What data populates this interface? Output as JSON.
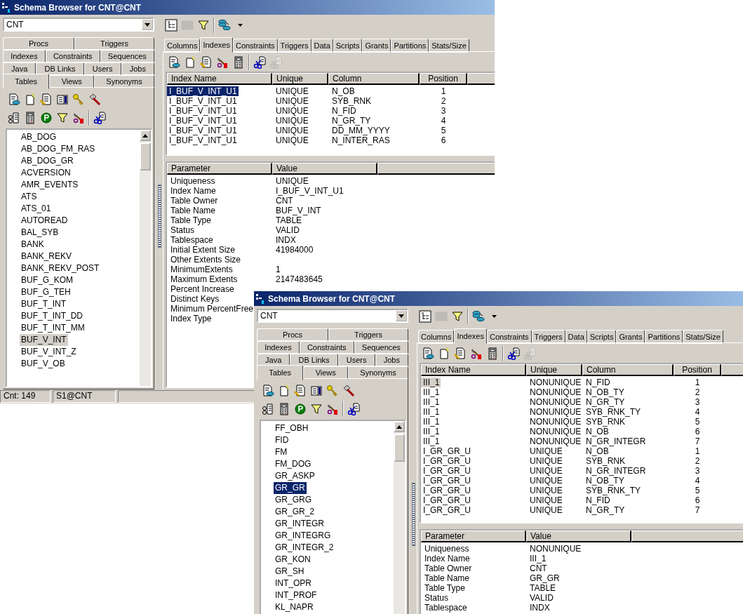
{
  "windows": [
    {
      "title": "Schema Browser for CNT@CNT",
      "list_focused": false,
      "schema": "CNT",
      "toolbar": [
        {
          "kind": "tree",
          "disabled": false
        },
        {
          "kind": "grid",
          "disabled": true
        },
        {
          "kind": "filter",
          "disabled": false
        },
        {
          "kind": "separator"
        },
        {
          "kind": "database",
          "disabled": false
        },
        {
          "kind": "caret",
          "disabled": false
        }
      ],
      "object_tabs": [
        [
          {
            "label": "Procs",
            "selected": false
          },
          {
            "label": "Triggers",
            "selected": false
          }
        ],
        [
          {
            "label": "Indexes",
            "selected": false
          },
          {
            "label": "Constraints",
            "selected": false
          },
          {
            "label": "Sequences",
            "selected": false
          }
        ],
        [
          {
            "label": "Java",
            "selected": false
          },
          {
            "label": "DB Links",
            "selected": false
          },
          {
            "label": "Users",
            "selected": false
          },
          {
            "label": "Jobs",
            "selected": false
          }
        ],
        [
          {
            "label": "Tables",
            "selected": true
          },
          {
            "label": "Views",
            "selected": false
          },
          {
            "label": "Synonyms",
            "selected": false
          }
        ]
      ],
      "object_toolbar": [
        [
          {
            "kind": "database-doc",
            "disabled": false
          },
          {
            "kind": "new-doc",
            "disabled": false
          },
          {
            "kind": "edit-doc",
            "disabled": false
          },
          {
            "kind": "columns",
            "disabled": false
          },
          {
            "kind": "key",
            "disabled": false
          },
          {
            "kind": "hammer",
            "disabled": false
          }
        ],
        [
          {
            "kind": "link-doc",
            "disabled": false
          },
          {
            "kind": "calculator",
            "disabled": false
          },
          {
            "kind": "p-circle",
            "disabled": false
          },
          {
            "kind": "filter",
            "disabled": false
          },
          {
            "kind": "tools",
            "disabled": false
          },
          {
            "kind": "separator"
          },
          {
            "kind": "scissors-doc",
            "disabled": false
          }
        ]
      ],
      "objects": [
        {
          "label": "AB_DOG",
          "selected": false
        },
        {
          "label": "AB_DOG_FM_RAS",
          "selected": false
        },
        {
          "label": "AB_DOG_GR",
          "selected": false
        },
        {
          "label": "ACVERSION",
          "selected": false
        },
        {
          "label": "AMR_EVENTS",
          "selected": false
        },
        {
          "label": "ATS",
          "selected": false
        },
        {
          "label": "ATS_01",
          "selected": false
        },
        {
          "label": "AUTOREAD",
          "selected": false
        },
        {
          "label": "BAL_SYB",
          "selected": false
        },
        {
          "label": "BANK",
          "selected": false
        },
        {
          "label": "BANK_REKV",
          "selected": false
        },
        {
          "label": "BANK_REKV_POST",
          "selected": false
        },
        {
          "label": "BUF_G_KOM",
          "selected": false
        },
        {
          "label": "BUF_G_TEH",
          "selected": false
        },
        {
          "label": "BUF_T_INT",
          "selected": false
        },
        {
          "label": "BUF_T_INT_DD",
          "selected": false
        },
        {
          "label": "BUF_T_INT_MM",
          "selected": false
        },
        {
          "label": "BUF_V_INT",
          "selected": true
        },
        {
          "label": "BUF_V_INT_Z",
          "selected": false
        },
        {
          "label": "BUF_V_OB",
          "selected": false
        }
      ],
      "detail_tabs": [
        {
          "label": "Columns",
          "selected": false
        },
        {
          "label": "Indexes",
          "selected": true
        },
        {
          "label": "Constraints",
          "selected": false
        },
        {
          "label": "Triggers",
          "selected": false
        },
        {
          "label": "Data",
          "selected": false
        },
        {
          "label": "Scripts",
          "selected": false
        },
        {
          "label": "Grants",
          "selected": false
        },
        {
          "label": "Partitions",
          "selected": false
        },
        {
          "label": "Stats/Size",
          "selected": false
        }
      ],
      "detail_toolbar": [
        {
          "kind": "database-doc",
          "disabled": false
        },
        {
          "kind": "new-doc",
          "disabled": false
        },
        {
          "kind": "edit-doc",
          "disabled": false
        },
        {
          "kind": "tools",
          "disabled": false
        },
        {
          "kind": "calculator",
          "disabled": false
        },
        {
          "kind": "separator"
        },
        {
          "kind": "scissors-doc",
          "disabled": false
        },
        {
          "kind": "scissors-doc",
          "disabled": true
        }
      ],
      "indexes": {
        "columns": [
          "Index Name",
          "Unique",
          "Column",
          "Position"
        ],
        "rows": [
          {
            "cells": [
              "I_BUF_V_INT_U1",
              "UNIQUE",
              "N_OB",
              "1"
            ],
            "selected": true
          },
          {
            "cells": [
              "I_BUF_V_INT_U1",
              "UNIQUE",
              "SYB_RNK",
              "2"
            ],
            "selected": false
          },
          {
            "cells": [
              "I_BUF_V_INT_U1",
              "UNIQUE",
              "N_FID",
              "3"
            ],
            "selected": false
          },
          {
            "cells": [
              "I_BUF_V_INT_U1",
              "UNIQUE",
              "N_GR_TY",
              "4"
            ],
            "selected": false
          },
          {
            "cells": [
              "I_BUF_V_INT_U1",
              "UNIQUE",
              "DD_MM_YYYY",
              "5"
            ],
            "selected": false
          },
          {
            "cells": [
              "I_BUF_V_INT_U1",
              "UNIQUE",
              "N_INTER_RAS",
              "6"
            ],
            "selected": false
          }
        ]
      },
      "parameters": {
        "columns": [
          "Parameter",
          "Value"
        ],
        "rows": [
          [
            "Uniqueness",
            "UNIQUE"
          ],
          [
            "Index Name",
            "I_BUF_V_INT_U1"
          ],
          [
            "Table Owner",
            "CNT"
          ],
          [
            "Table Name",
            "BUF_V_INT"
          ],
          [
            "Table Type",
            "TABLE"
          ],
          [
            "Status",
            "VALID"
          ],
          [
            "Tablespace",
            "INDX"
          ],
          [
            "Initial Extent Size",
            "41984000"
          ],
          [
            "Other Extents Size"
          ],
          [
            "MinimumExtents",
            "1"
          ],
          [
            "Maximum Extents",
            "2147483645"
          ],
          [
            "Percent Increase"
          ],
          [
            "Distinct Keys"
          ],
          [
            "Minimum PercentFree"
          ],
          [
            "Index Type"
          ]
        ]
      },
      "status_bar": [
        "Cnt: 149",
        "S1@CNT"
      ]
    },
    {
      "title": "Schema Browser for CNT@CNT",
      "list_focused": true,
      "schema": "CNT",
      "toolbar": [
        {
          "kind": "tree",
          "disabled": false
        },
        {
          "kind": "grid",
          "disabled": true
        },
        {
          "kind": "filter",
          "disabled": false
        },
        {
          "kind": "separator"
        },
        {
          "kind": "database",
          "disabled": false
        },
        {
          "kind": "caret",
          "disabled": false
        }
      ],
      "object_tabs": [
        [
          {
            "label": "Procs",
            "selected": false
          },
          {
            "label": "Triggers",
            "selected": false
          }
        ],
        [
          {
            "label": "Indexes",
            "selected": false
          },
          {
            "label": "Constraints",
            "selected": false
          },
          {
            "label": "Sequences",
            "selected": false
          }
        ],
        [
          {
            "label": "Java",
            "selected": false
          },
          {
            "label": "DB Links",
            "selected": false
          },
          {
            "label": "Users",
            "selected": false
          },
          {
            "label": "Jobs",
            "selected": false
          }
        ],
        [
          {
            "label": "Tables",
            "selected": true
          },
          {
            "label": "Views",
            "selected": false
          },
          {
            "label": "Synonyms",
            "selected": false
          }
        ]
      ],
      "object_toolbar": [
        [
          {
            "kind": "database-doc",
            "disabled": false
          },
          {
            "kind": "new-doc",
            "disabled": false
          },
          {
            "kind": "edit-doc",
            "disabled": false
          },
          {
            "kind": "columns",
            "disabled": false
          },
          {
            "kind": "key",
            "disabled": false
          },
          {
            "kind": "hammer",
            "disabled": false
          }
        ],
        [
          {
            "kind": "link-doc",
            "disabled": false
          },
          {
            "kind": "calculator",
            "disabled": false
          },
          {
            "kind": "p-circle",
            "disabled": false
          },
          {
            "kind": "filter",
            "disabled": false
          },
          {
            "kind": "tools",
            "disabled": false
          },
          {
            "kind": "separator"
          },
          {
            "kind": "scissors-doc",
            "disabled": false
          }
        ]
      ],
      "objects": [
        {
          "label": "FF_OBH",
          "selected": false
        },
        {
          "label": "FID",
          "selected": false
        },
        {
          "label": "FM",
          "selected": false
        },
        {
          "label": "FM_DOG",
          "selected": false
        },
        {
          "label": "GR_ASKP",
          "selected": false
        },
        {
          "label": "GR_GR",
          "selected": true
        },
        {
          "label": "GR_GRG",
          "selected": false
        },
        {
          "label": "GR_GR_2",
          "selected": false
        },
        {
          "label": "GR_INTEGR",
          "selected": false
        },
        {
          "label": "GR_INTEGRG",
          "selected": false
        },
        {
          "label": "GR_INTEGR_2",
          "selected": false
        },
        {
          "label": "GR_KON",
          "selected": false
        },
        {
          "label": "GR_SH",
          "selected": false
        },
        {
          "label": "INT_OPR",
          "selected": false
        },
        {
          "label": "INT_PROF",
          "selected": false
        },
        {
          "label": "KL_NAPR",
          "selected": false
        }
      ],
      "detail_tabs": [
        {
          "label": "Columns",
          "selected": false
        },
        {
          "label": "Indexes",
          "selected": true
        },
        {
          "label": "Constraints",
          "selected": false
        },
        {
          "label": "Triggers",
          "selected": false
        },
        {
          "label": "Data",
          "selected": false
        },
        {
          "label": "Scripts",
          "selected": false
        },
        {
          "label": "Grants",
          "selected": false
        },
        {
          "label": "Partitions",
          "selected": false
        },
        {
          "label": "Stats/Size",
          "selected": false
        }
      ],
      "detail_toolbar": [
        {
          "kind": "database-doc",
          "disabled": false
        },
        {
          "kind": "new-doc",
          "disabled": false
        },
        {
          "kind": "edit-doc",
          "disabled": false
        },
        {
          "kind": "tools",
          "disabled": false
        },
        {
          "kind": "calculator",
          "disabled": false
        },
        {
          "kind": "separator"
        },
        {
          "kind": "scissors-doc",
          "disabled": false
        },
        {
          "kind": "scissors-doc",
          "disabled": true
        }
      ],
      "indexes": {
        "columns": [
          "Index Name",
          "Unique",
          "Column",
          "Position"
        ],
        "rows": [
          {
            "cells": [
              "III_1",
              "NONUNIQUE",
              "N_FID",
              "1"
            ],
            "selected": true
          },
          {
            "cells": [
              "III_1",
              "NONUNIQUE",
              "N_OB_TY",
              "2"
            ],
            "selected": false
          },
          {
            "cells": [
              "III_1",
              "NONUNIQUE",
              "N_GR_TY",
              "3"
            ],
            "selected": false
          },
          {
            "cells": [
              "III_1",
              "NONUNIQUE",
              "SYB_RNK_TY",
              "4"
            ],
            "selected": false
          },
          {
            "cells": [
              "III_1",
              "NONUNIQUE",
              "SYB_RNK",
              "5"
            ],
            "selected": false
          },
          {
            "cells": [
              "III_1",
              "NONUNIQUE",
              "N_OB",
              "6"
            ],
            "selected": false
          },
          {
            "cells": [
              "III_1",
              "NONUNIQUE",
              "N_GR_INTEGR",
              "7"
            ],
            "selected": false
          },
          {
            "cells": [
              "I_GR_GR_U",
              "UNIQUE",
              "N_OB",
              "1"
            ],
            "selected": false
          },
          {
            "cells": [
              "I_GR_GR_U",
              "UNIQUE",
              "SYB_RNK",
              "2"
            ],
            "selected": false
          },
          {
            "cells": [
              "I_GR_GR_U",
              "UNIQUE",
              "N_GR_INTEGR",
              "3"
            ],
            "selected": false
          },
          {
            "cells": [
              "I_GR_GR_U",
              "UNIQUE",
              "N_OB_TY",
              "4"
            ],
            "selected": false
          },
          {
            "cells": [
              "I_GR_GR_U",
              "UNIQUE",
              "SYB_RNK_TY",
              "5"
            ],
            "selected": false
          },
          {
            "cells": [
              "I_GR_GR_U",
              "UNIQUE",
              "N_FID",
              "6"
            ],
            "selected": false
          },
          {
            "cells": [
              "I_GR_GR_U",
              "UNIQUE",
              "N_GR_TY",
              "7"
            ],
            "selected": false
          }
        ]
      },
      "parameters": {
        "columns": [
          "Parameter",
          "Value"
        ],
        "rows": [
          [
            "Uniqueness",
            "NONUNIQUE"
          ],
          [
            "Index Name",
            "III_1"
          ],
          [
            "Table Owner",
            "CNT"
          ],
          [
            "Table Name",
            "GR_GR"
          ],
          [
            "Table Type",
            "TABLE"
          ],
          [
            "Status",
            "VALID"
          ],
          [
            "Tablespace",
            "INDX"
          ]
        ]
      }
    }
  ]
}
